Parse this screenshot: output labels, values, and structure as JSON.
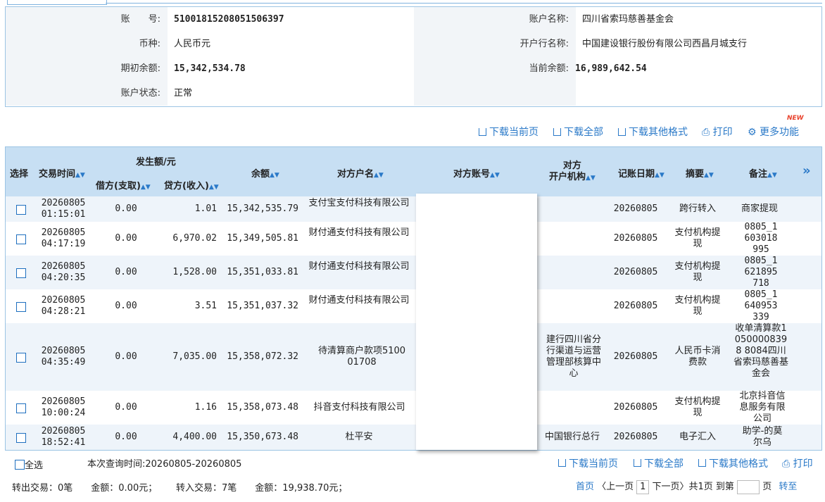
{
  "account_info": {
    "account_no_label": "账　　号:",
    "account_no": "51001815208051506397",
    "account_name_label": "账户名称:",
    "account_name": "四川省索玛慈善基金会",
    "currency_label": "币种:",
    "currency": "人民币元",
    "bank_label": "开户行名称:",
    "bank": "中国建设银行股份有限公司西昌月城支行",
    "opening_balance_label": "期初余额:",
    "opening_balance": "15,342,534.78",
    "current_balance_label": "当前余额:",
    "current_balance": "16,989,642.54",
    "status_label": "账户状态:",
    "status": "正常"
  },
  "toolbar": {
    "new_badge": "NEW",
    "download_page": "下载当前页",
    "download_all": "下载全部",
    "download_other": "下载其他格式",
    "print": "打印",
    "more": "更多功能"
  },
  "table": {
    "headers": {
      "select": "选择",
      "time": "交易时间",
      "amount_group": "发生额/元",
      "debit": "借方(支取)",
      "credit": "贷方(收入)",
      "balance": "余额",
      "counter_name": "对方户名",
      "counter_account": "对方账号",
      "counter_bank_1": "对方",
      "counter_bank_2": "开户机构",
      "post_date": "记账日期",
      "summary": "摘要",
      "remark": "备注",
      "more": "»"
    },
    "rows": [
      {
        "date": "20260805",
        "time": "01:15:01",
        "debit": "0.00",
        "credit": "1.01",
        "balance": "15,342,535.79",
        "name": "支付宝支付科技有限公司",
        "bank": "",
        "post": "20260805",
        "summary": "跨行转入",
        "remark": "商家提现"
      },
      {
        "date": "20260805",
        "time": "04:17:19",
        "debit": "0.00",
        "credit": "6,970.02",
        "balance": "15,349,505.81",
        "name": "财付通支付科技有限公司",
        "bank": "",
        "post": "20260805",
        "summary": "支付机构提现",
        "remark": "0805_1603018995"
      },
      {
        "date": "20260805",
        "time": "04:20:35",
        "debit": "0.00",
        "credit": "1,528.00",
        "balance": "15,351,033.81",
        "name": "财付通支付科技有限公司",
        "bank": "",
        "post": "20260805",
        "summary": "支付机构提现",
        "remark": "0805_1621895718"
      },
      {
        "date": "20260805",
        "time": "04:28:21",
        "debit": "0.00",
        "credit": "3.51",
        "balance": "15,351,037.32",
        "name": "财付通支付科技有限公司",
        "bank": "",
        "post": "20260805",
        "summary": "支付机构提现",
        "remark": "0805_1640953339"
      },
      {
        "date": "20260805",
        "time": "04:35:49",
        "debit": "0.00",
        "credit": "7,035.00",
        "balance": "15,358,072.32",
        "name": "待清算商户款项510001708",
        "bank": "建行四川省分行渠道与运营管理部核算中心",
        "post": "20260805",
        "summary": "人民币卡消费款",
        "remark": "收单清算款10500008398 8084四川省索玛慈善基金会"
      },
      {
        "date": "20260805",
        "time": "10:00:24",
        "debit": "0.00",
        "credit": "1.16",
        "balance": "15,358,073.48",
        "name": "抖音支付科技有限公司",
        "bank": "",
        "post": "20260805",
        "summary": "支付机构提现",
        "remark": "北京抖音信息服务有限公司"
      },
      {
        "date": "20260805",
        "time": "18:52:41",
        "debit": "0.00",
        "credit": "4,400.00",
        "balance": "15,350,673.48",
        "name": "杜平安",
        "bank": "中国银行总行",
        "post": "20260805",
        "summary": "电子汇入",
        "remark": "助学-的莫尔乌"
      }
    ]
  },
  "footer": {
    "select_all": "全选",
    "query_time": "本次查询时间:20260805-20260805",
    "download_page": "下载当前页",
    "download_all": "下载全部",
    "download_other": "下载其他格式",
    "print": "打印",
    "summary_out": "转出交易：0笔　　金额：0.00元；",
    "summary_in": "转入交易：7笔　　金额：19,938.70元；",
    "first": "首页",
    "prev": "〈上一页",
    "page": "1",
    "next": "下一页〉",
    "total": "共1页",
    "goto": "到第",
    "page_unit": "页",
    "go": "转至"
  },
  "colors": {
    "accent": "#2a79c8",
    "header_bg": "#c7dff3",
    "border": "#9cc4e4",
    "new_badge": "#e8412b"
  }
}
